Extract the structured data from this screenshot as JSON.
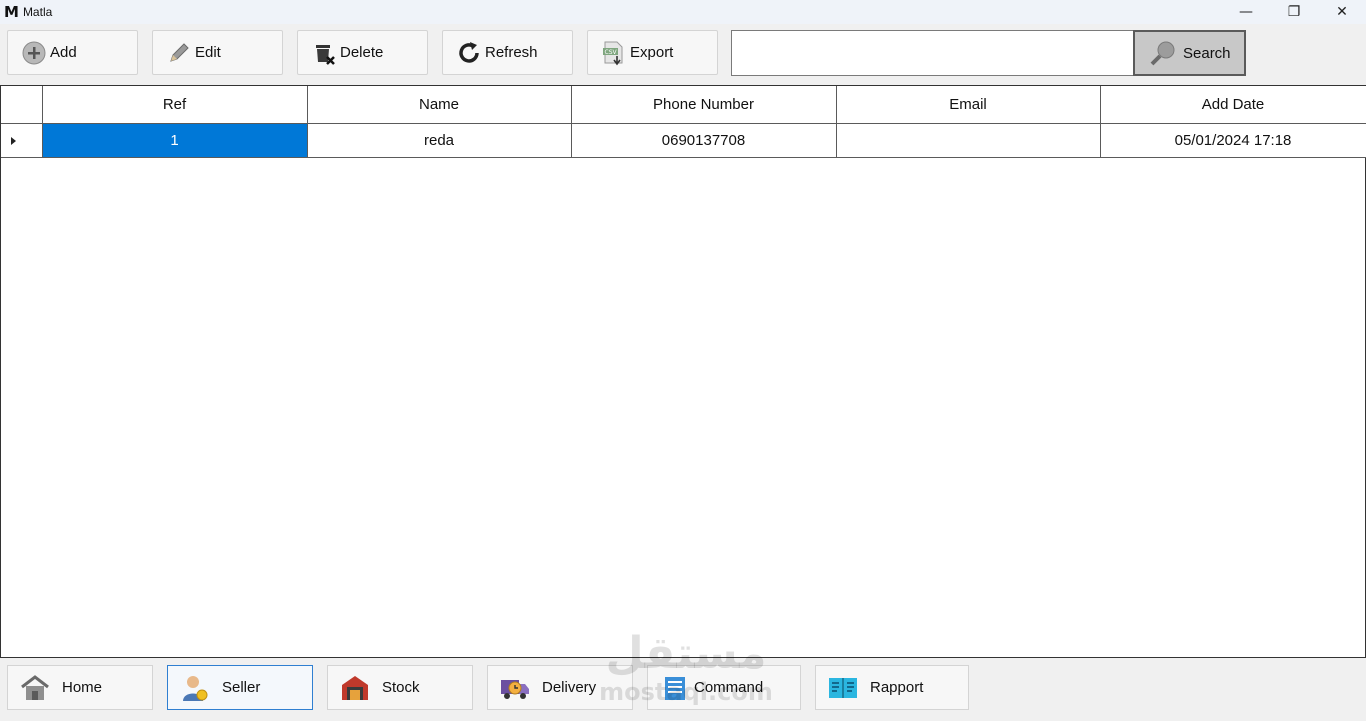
{
  "window": {
    "logo": "M",
    "title": "Matla",
    "minimize": "—",
    "maximize": "❐",
    "close": "✕"
  },
  "toolbar": {
    "add_label": "Add",
    "edit_label": "Edit",
    "delete_label": "Delete",
    "refresh_label": "Refresh",
    "export_label": "Export",
    "search_value": "",
    "search_label": "Search",
    "export_icon_text": "CSV"
  },
  "grid": {
    "columns": [
      "Ref",
      "Name",
      "Phone Number",
      "Email",
      "Add Date"
    ],
    "rows": [
      {
        "ref": "1",
        "name": "reda",
        "phone": "0690137708",
        "email": "",
        "add_date": "05/01/2024 17:18"
      }
    ]
  },
  "nav": {
    "home": "Home",
    "seller": "Seller",
    "stock": "Stock",
    "delivery": "Delivery",
    "command": "Command",
    "rapport": "Rapport",
    "active": "seller"
  },
  "watermark": {
    "arabic": "مستقل",
    "latin": "mostaql.com"
  },
  "colors": {
    "selection": "#0078d7",
    "active_nav_border": "#2f7fd1",
    "search_button_bg": "#c8c8c8"
  }
}
